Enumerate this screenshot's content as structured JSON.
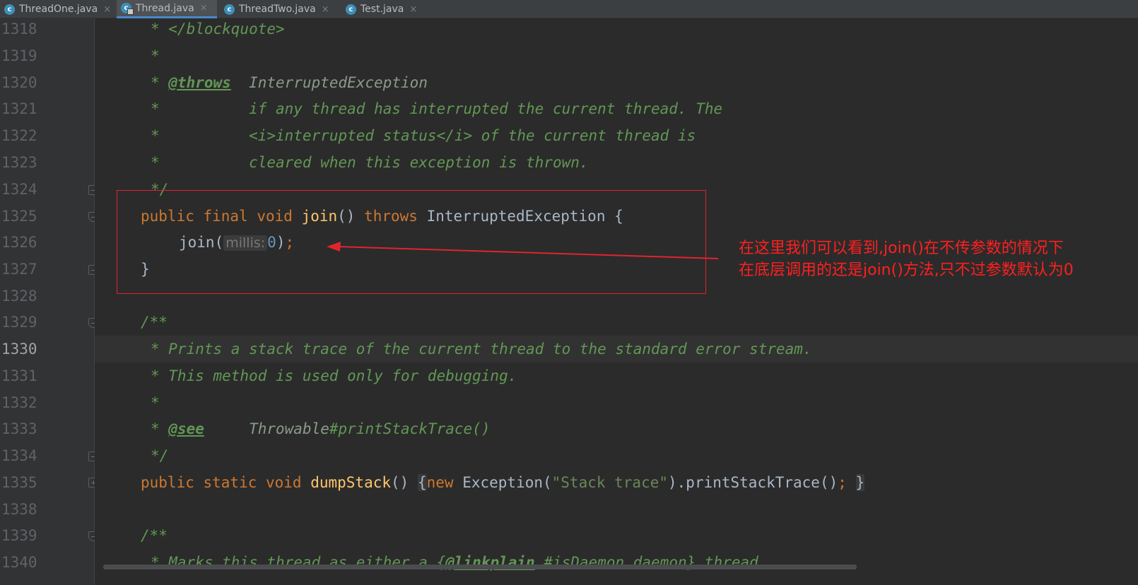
{
  "tabs": [
    {
      "label": "ThreadOne.java",
      "icon": "class-icon",
      "active": false
    },
    {
      "label": "Thread.java",
      "icon": "class-icon",
      "active": true
    },
    {
      "label": "ThreadTwo.java",
      "icon": "class-icon",
      "active": false
    },
    {
      "label": "Test.java",
      "icon": "class-icon",
      "active": false
    }
  ],
  "tab_close_glyph": "×",
  "line_numbers": [
    "1318",
    "1319",
    "1320",
    "1321",
    "1322",
    "1323",
    "1324",
    "1325",
    "1326",
    "1327",
    "1328",
    "1329",
    "1330",
    "1331",
    "1332",
    "1333",
    "1334",
    "1335",
    "1338",
    "1339",
    "1340"
  ],
  "current_line": "1330",
  "code": {
    "l1318": "* </blockquote>",
    "l1319": "*",
    "l1320_star": "* ",
    "l1320_tag": "@throws",
    "l1320_ref": "  InterruptedException",
    "l1321": "*          if any thread has interrupted the current thread. The",
    "l1322": "*          <i>interrupted status</i> of the current thread is",
    "l1323": "*          cleared when this exception is thrown.",
    "l1324": "*/",
    "l1325_kw": "public final void ",
    "l1325_fn": "join",
    "l1325_rest": "() ",
    "l1325_throws": "throws",
    "l1325_tail": " InterruptedException {",
    "l1326_call": "join(",
    "l1326_hint": "millis:",
    "l1326_num": "0",
    "l1326_close": ")",
    "l1326_semi": ";",
    "l1327": "}",
    "l1329": "/**",
    "l1330": "* Prints a stack trace of the current thread to the standard error stream.",
    "l1331": "* This method is used only for debugging.",
    "l1332": "*",
    "l1333_star": "* ",
    "l1333_tag": "@see",
    "l1333_ref": "     Throwable",
    "l1333_rest": "#printStackTrace()",
    "l1334": "*/",
    "l1335_kw": "public static void ",
    "l1335_fn": "dumpStack",
    "l1335_paren": "()",
    "l1335_open": "{",
    "l1335_new": "new",
    "l1335_cls": " Exception(",
    "l1335_str": "\"Stack trace\"",
    "l1335_call": ").printStackTrace()",
    "l1335_semi": ";",
    "l1335_close": "}",
    "l1339": "/**",
    "l1340_a": "* Marks this thread as either a {",
    "l1340_tag": "@linkplain",
    "l1340_b": " #isDaemon daemon} thread"
  },
  "annotation": {
    "line1": "在这里我们可以看到,join()在不传参数的情况下",
    "line2": "在底层调用的还是join()方法,只不过参数默认为0"
  },
  "colors": {
    "background": "#2b2b2b",
    "gutter": "#313335",
    "comment": "#629755",
    "keyword": "#cc7832",
    "function": "#ffc66d",
    "number": "#6897bb",
    "annotation_red": "#ff1f1f"
  }
}
